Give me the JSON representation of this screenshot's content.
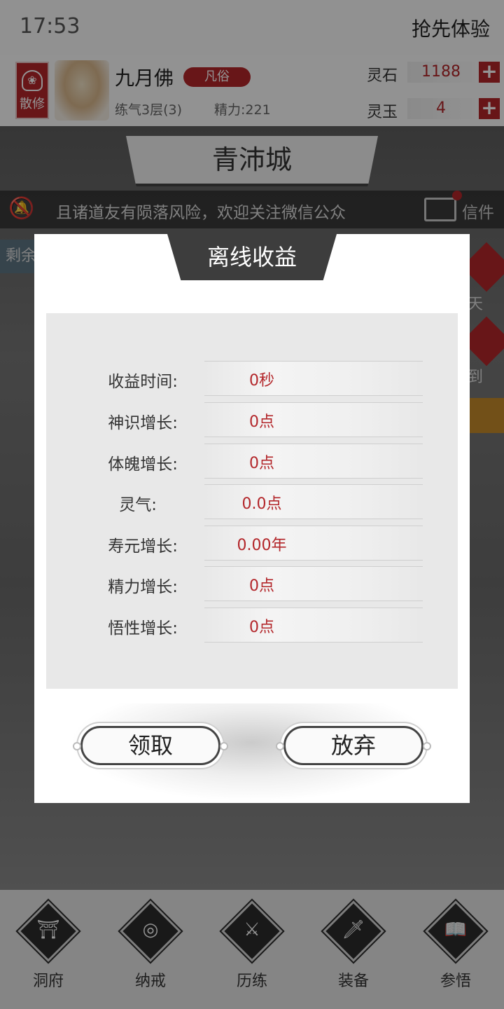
{
  "status": {
    "time": "17:53",
    "action": "抢先体验"
  },
  "profile": {
    "sect": "散修",
    "name": "九月佛",
    "rank": "凡俗",
    "level": "练气3层(3)",
    "energy": "精力:221",
    "resources": [
      {
        "label": "灵石",
        "value": "1188"
      },
      {
        "label": "灵玉",
        "value": "4"
      }
    ],
    "plus_symbol": "+"
  },
  "city": {
    "name": "青沛城"
  },
  "notice": {
    "text": "且诸道友有陨落风险，欢迎关注微信公众",
    "mail_label": "信件"
  },
  "side": {
    "left_tag": "剩余",
    "right_labels": [
      "天",
      "到"
    ]
  },
  "modal": {
    "title": "离线收益",
    "rows": [
      {
        "label": "收益时间:",
        "value": "0秒"
      },
      {
        "label": "神识增长:",
        "value": "0点"
      },
      {
        "label": "体魄增长:",
        "value": "0点"
      },
      {
        "label": "灵气:",
        "value": "0.0点"
      },
      {
        "label": "寿元增长:",
        "value": "0.00年"
      },
      {
        "label": "精力增长:",
        "value": "0点"
      },
      {
        "label": "悟性增长:",
        "value": "0点"
      }
    ],
    "claim_label": "领取",
    "abandon_label": "放弃"
  },
  "nav": [
    {
      "label": "洞府",
      "icon": "cave-icon"
    },
    {
      "label": "纳戒",
      "icon": "ring-icon"
    },
    {
      "label": "历练",
      "icon": "swords-icon"
    },
    {
      "label": "装备",
      "icon": "sword-icon"
    },
    {
      "label": "参悟",
      "icon": "book-icon"
    }
  ],
  "colors": {
    "accent": "#b3262a",
    "modal_title_bg": "#3d3d3d",
    "nav_icon": "#2c2c2c"
  }
}
